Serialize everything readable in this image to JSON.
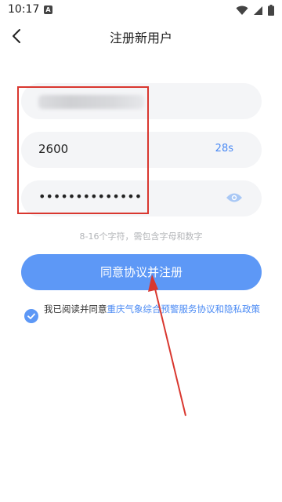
{
  "status_bar": {
    "time": "10:17",
    "notification_glyph": "A",
    "icons": [
      "wifi-icon",
      "signal-icon",
      "battery-icon"
    ]
  },
  "header": {
    "title": "注册新用户",
    "back_icon": "chevron-left-icon"
  },
  "form": {
    "phone_value_obscured": true,
    "code_value": "2600",
    "countdown_label": "28s",
    "password_value": "••••••••••••••",
    "password_toggle_icon": "eye-icon",
    "hint": "8-16个字符，需包含字母和数字"
  },
  "register_button": {
    "label": "同意协议并注册"
  },
  "agreement": {
    "checked": true,
    "prefix": "我已阅读并同意",
    "link": "重庆气象综合预警服务协议和隐私政策"
  },
  "colors": {
    "accent": "#5d98f6",
    "link": "#4a8af4",
    "annotation": "#d9372f",
    "field_bg": "#f4f5f7"
  }
}
